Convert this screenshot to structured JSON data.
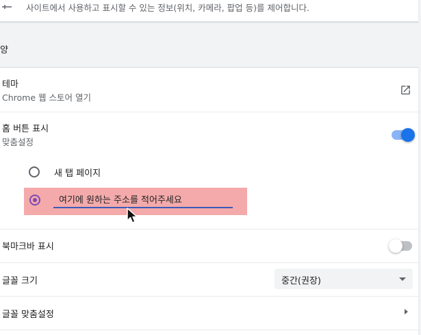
{
  "site_settings": {
    "description": "사이트에서 사용하고 표시할 수 있는 정보(위치, 카메라, 팝업 등)를 제어합니다.",
    "icon": "sliders-icon"
  },
  "section": {
    "title": "양"
  },
  "theme": {
    "label": "테마",
    "sublabel": "Chrome 웹 스토어 열기",
    "icon": "open-in-new-icon"
  },
  "home_button": {
    "label": "홈 버튼 표시",
    "sublabel": "맞춤설정",
    "enabled": true,
    "options": [
      {
        "label": "새 탭 페이지",
        "selected": false
      },
      {
        "label": "",
        "selected": true
      }
    ],
    "url_value": "여기에 원하는 주소를 적어주세요"
  },
  "bookmarks_bar": {
    "label": "북마크바 표시",
    "enabled": false
  },
  "font_size": {
    "label": "글꼴 크기",
    "selected": "중간(권장)"
  },
  "customize_fonts": {
    "label": "글꼴 맞춤설정"
  },
  "colors": {
    "accent": "#1a73e8",
    "highlight": "#f4aaaa",
    "text_secondary": "#5f6368"
  }
}
